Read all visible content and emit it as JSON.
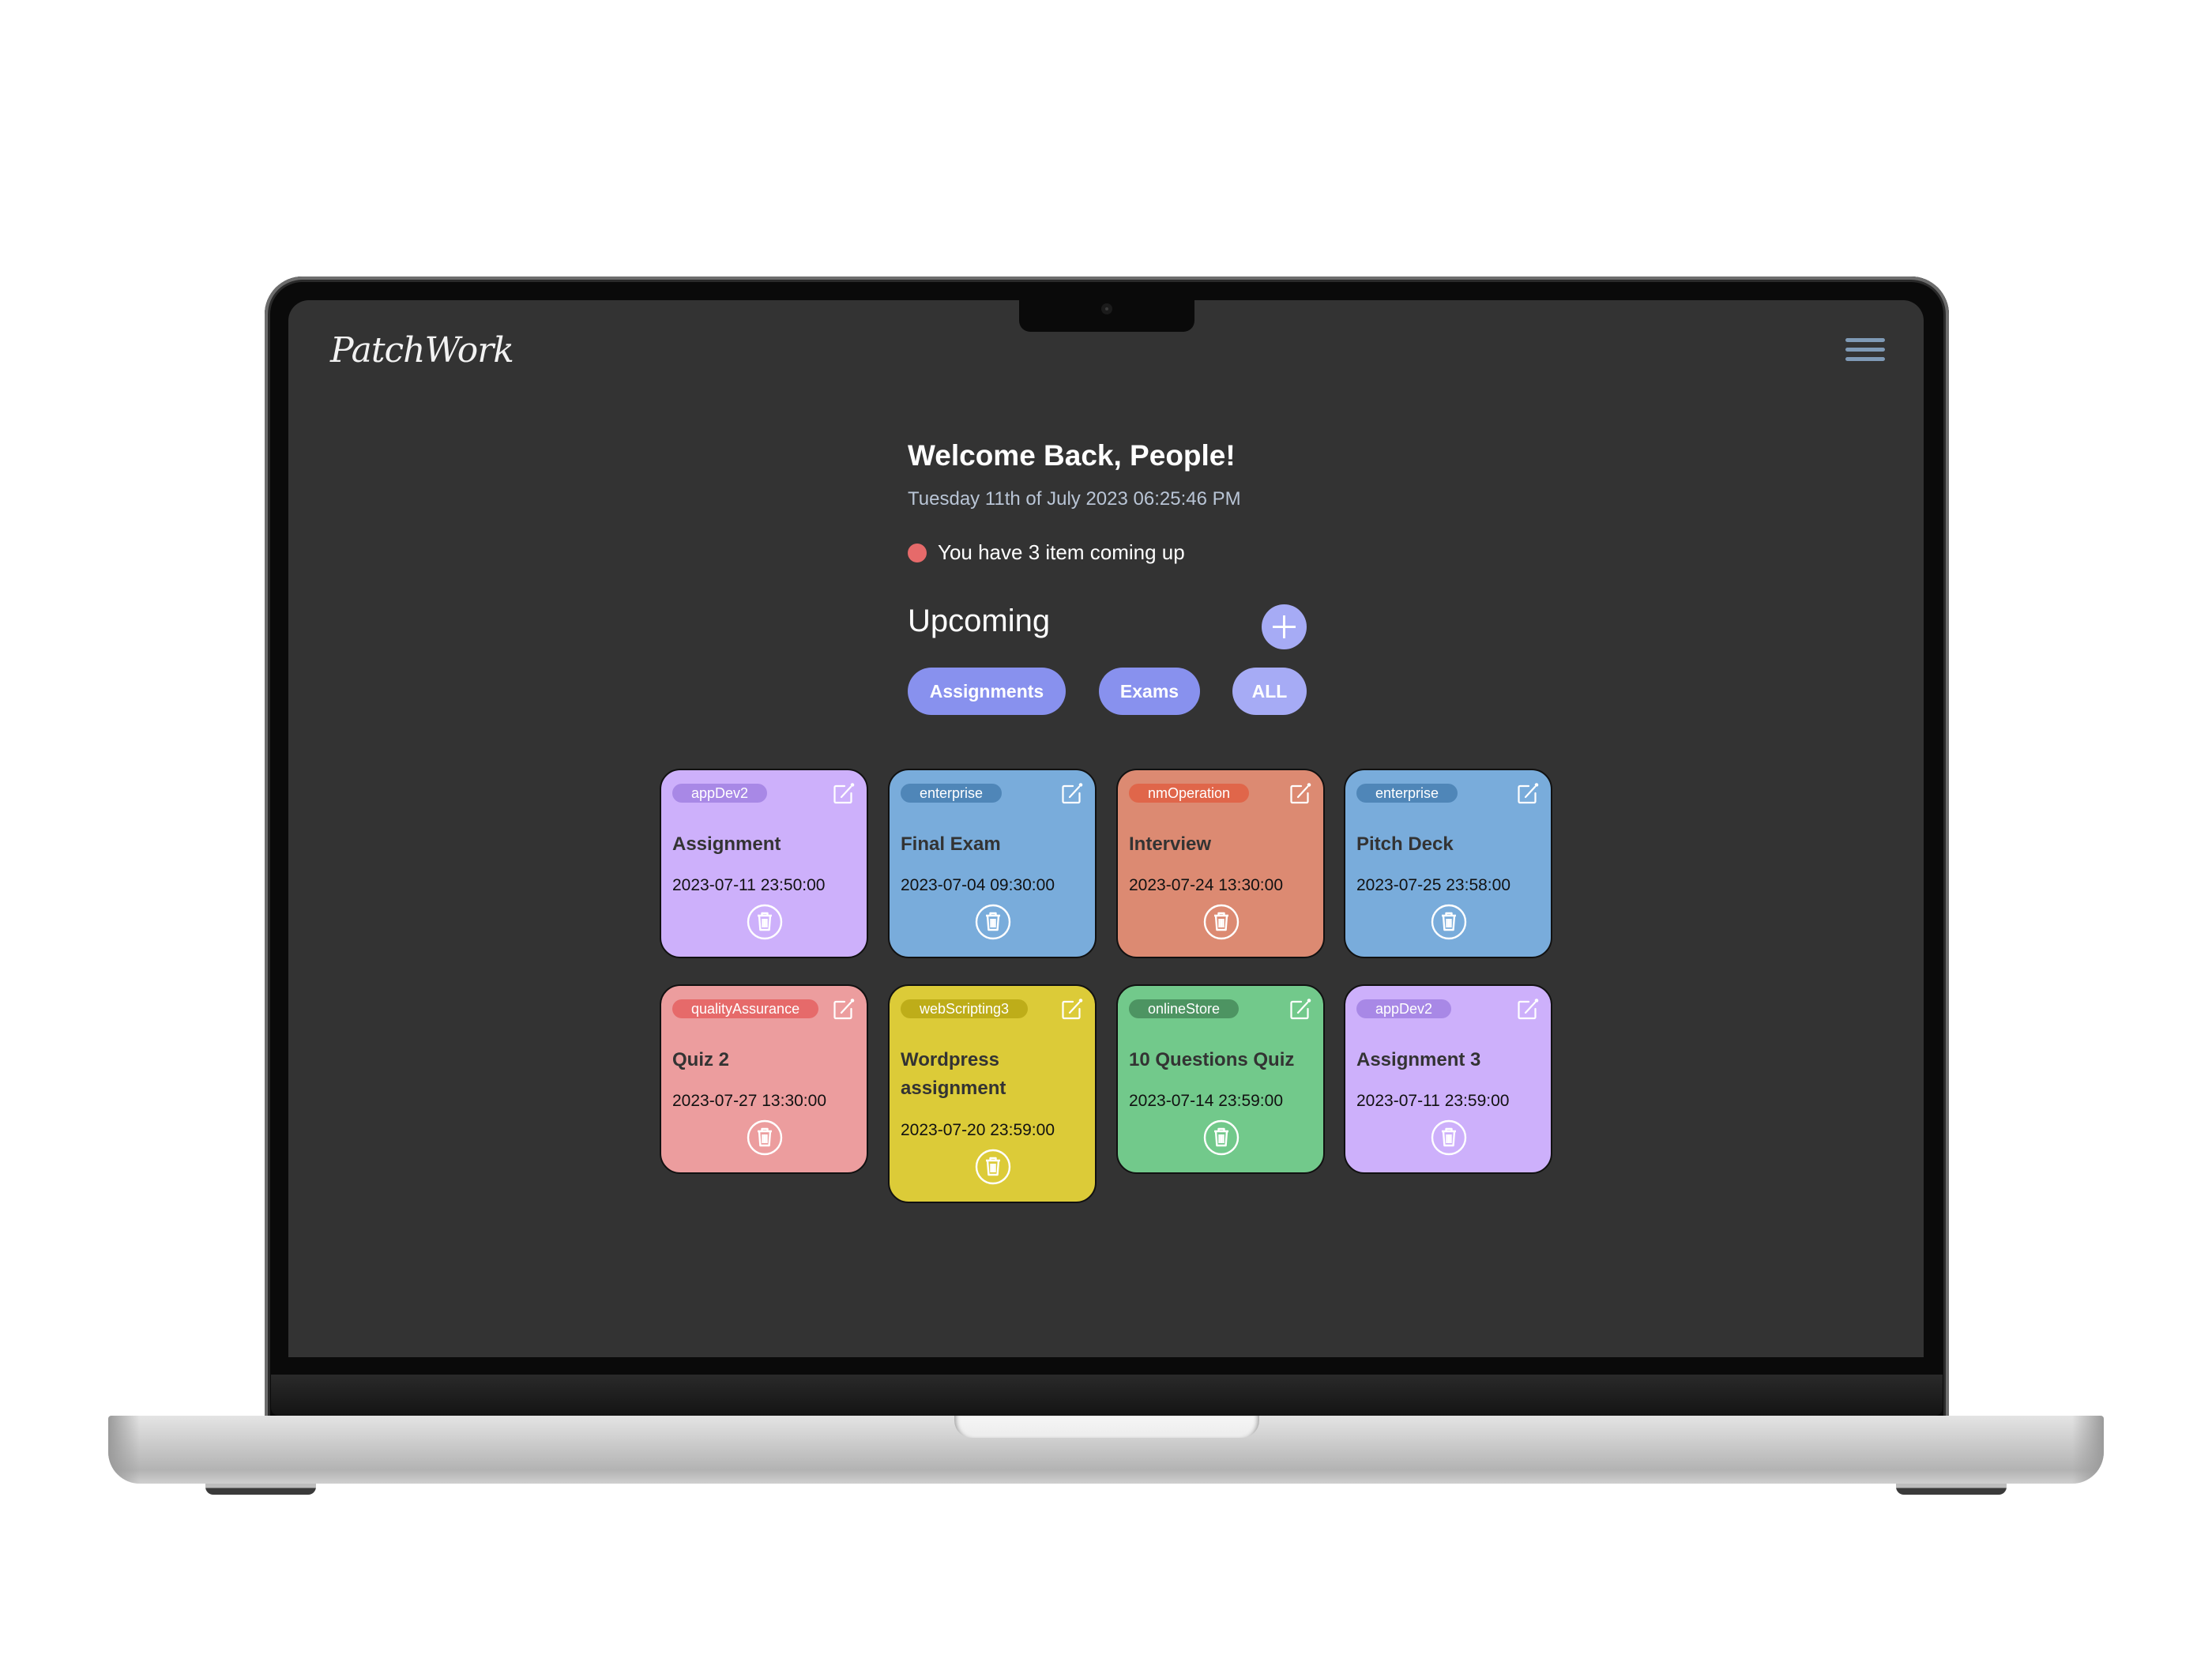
{
  "app": {
    "logo_text": "PatchWork",
    "menu_icon": "hamburger-menu-icon"
  },
  "header": {
    "welcome": "Welcome Back, People!",
    "datetime": "Tuesday 11th of July 2023 06:25:46 PM",
    "upcoming_note": "You have 3 item coming up",
    "upcoming_dot_color": "#e66a6a"
  },
  "upcoming": {
    "title": "Upcoming",
    "add_icon": "plus-icon",
    "filters": [
      {
        "label": "Assignments"
      },
      {
        "label": "Exams"
      },
      {
        "label": "ALL"
      }
    ]
  },
  "colors": {
    "background": "#333333",
    "accent": "#8891ee",
    "accent_light": "#a6abf5"
  },
  "cards": [
    {
      "tag": "appDev2",
      "title": "Assignment",
      "date": "2023-07-11 23:50:00",
      "bg": "#cdb0fb",
      "tag_bg": "#a888e6"
    },
    {
      "tag": "enterprise",
      "title": "Final Exam",
      "date": "2023-07-04 09:30:00",
      "bg": "#79acdb",
      "tag_bg": "#4f86b8"
    },
    {
      "tag": "nmOperation",
      "title": "Interview",
      "date": "2023-07-24 13:30:00",
      "bg": "#dc8a72",
      "tag_bg": "#e0664a"
    },
    {
      "tag": "enterprise",
      "title": "Pitch Deck",
      "date": "2023-07-25 23:58:00",
      "bg": "#79acdb",
      "tag_bg": "#4f86b8"
    },
    {
      "tag": "qualityAssurance",
      "title": "Quiz 2",
      "date": "2023-07-27 13:30:00",
      "bg": "#ec9d9e",
      "tag_bg": "#e66a6a"
    },
    {
      "tag": "webScripting3",
      "title": "Wordpress assignment",
      "date": "2023-07-20 23:59:00",
      "bg": "#dccb38",
      "tag_bg": "#bead19"
    },
    {
      "tag": "onlineStore",
      "title": "10 Questions Quiz",
      "date": "2023-07-14 23:59:00",
      "bg": "#72c98b",
      "tag_bg": "#4d9462"
    },
    {
      "tag": "appDev2",
      "title": "Assignment 3",
      "date": "2023-07-11 23:59:00",
      "bg": "#cdb0fb",
      "tag_bg": "#a888e6"
    }
  ]
}
